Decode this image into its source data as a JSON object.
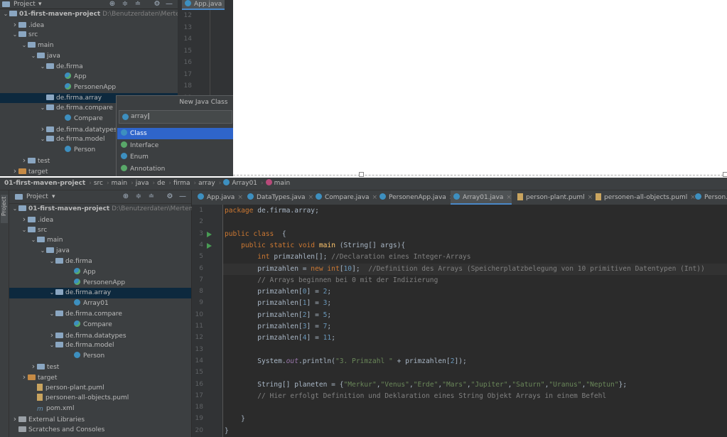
{
  "top": {
    "panel_title": "Project",
    "editor_tab": "App.java",
    "gutter_lines": [
      "12",
      "13",
      "14",
      "15",
      "16",
      "17",
      "18",
      "19"
    ],
    "tree": [
      {
        "label": "01-first-maven-project",
        "path": "D:\\Benutzerdaten\\Mertens_Ach",
        "indent": 0,
        "arrow": "down",
        "icon": "folder"
      },
      {
        "label": ".idea",
        "indent": 1,
        "arrow": "right",
        "icon": "folder"
      },
      {
        "label": "src",
        "indent": 1,
        "arrow": "down",
        "icon": "folder"
      },
      {
        "label": "main",
        "indent": 2,
        "arrow": "down",
        "icon": "folder"
      },
      {
        "label": "java",
        "indent": 3,
        "arrow": "down",
        "icon": "folder"
      },
      {
        "label": "de.firma",
        "indent": 4,
        "arrow": "down",
        "icon": "pkg"
      },
      {
        "label": "App",
        "indent": 6,
        "arrow": "",
        "icon": "class-run"
      },
      {
        "label": "PersonenApp",
        "indent": 6,
        "arrow": "",
        "icon": "class-run"
      },
      {
        "label": "de.firma.array",
        "indent": 4,
        "arrow": "",
        "icon": "pkg",
        "selected": true
      },
      {
        "label": "de.firma.compare",
        "indent": 4,
        "arrow": "down",
        "icon": "pkg"
      },
      {
        "label": "Compare",
        "indent": 6,
        "arrow": "",
        "icon": "class"
      },
      {
        "label": "de.firma.datatypes",
        "indent": 4,
        "arrow": "right",
        "icon": "pkg"
      },
      {
        "label": "de.firma.model",
        "indent": 4,
        "arrow": "down",
        "icon": "pkg"
      },
      {
        "label": "Person",
        "indent": 6,
        "arrow": "",
        "icon": "class"
      },
      {
        "label": "test",
        "indent": 2,
        "arrow": "right",
        "icon": "folder"
      },
      {
        "label": "target",
        "indent": 1,
        "arrow": "right",
        "icon": "orange"
      }
    ],
    "popup": {
      "title": "New Java Class",
      "input_value": "array",
      "items": [
        {
          "label": "Class",
          "color": "#3d8fbf",
          "selected": true
        },
        {
          "label": "Interface",
          "color": "#59a869"
        },
        {
          "label": "Enum",
          "color": "#3d8fbf"
        },
        {
          "label": "Annotation",
          "color": "#59a869"
        }
      ]
    }
  },
  "breadcrumb": [
    "01-first-maven-project",
    "src",
    "main",
    "java",
    "de",
    "firma",
    "array",
    "Array01",
    "main"
  ],
  "main": {
    "panel_title": "Project",
    "side_label": "Project",
    "tree": [
      {
        "label": "01-first-maven-project",
        "path": "D:\\Benutzerdaten\\Mertens_Ach",
        "indent": 0,
        "arrow": "down",
        "icon": "folder"
      },
      {
        "label": ".idea",
        "indent": 1,
        "arrow": "right",
        "icon": "folder"
      },
      {
        "label": "src",
        "indent": 1,
        "arrow": "down",
        "icon": "folder"
      },
      {
        "label": "main",
        "indent": 2,
        "arrow": "down",
        "icon": "folder"
      },
      {
        "label": "java",
        "indent": 3,
        "arrow": "down",
        "icon": "folder"
      },
      {
        "label": "de.firma",
        "indent": 4,
        "arrow": "down",
        "icon": "pkg"
      },
      {
        "label": "App",
        "indent": 6,
        "arrow": "",
        "icon": "class-run"
      },
      {
        "label": "PersonenApp",
        "indent": 6,
        "arrow": "",
        "icon": "class-run"
      },
      {
        "label": "de.firma.array",
        "indent": 4,
        "arrow": "down",
        "icon": "pkg",
        "selected": true
      },
      {
        "label": "Array01",
        "indent": 6,
        "arrow": "",
        "icon": "class"
      },
      {
        "label": "de.firma.compare",
        "indent": 4,
        "arrow": "down",
        "icon": "pkg"
      },
      {
        "label": "Compare",
        "indent": 6,
        "arrow": "",
        "icon": "class-run"
      },
      {
        "label": "de.firma.datatypes",
        "indent": 4,
        "arrow": "right",
        "icon": "pkg"
      },
      {
        "label": "de.firma.model",
        "indent": 4,
        "arrow": "down",
        "icon": "pkg"
      },
      {
        "label": "Person",
        "indent": 6,
        "arrow": "",
        "icon": "class"
      },
      {
        "label": "test",
        "indent": 2,
        "arrow": "right",
        "icon": "folder"
      },
      {
        "label": "target",
        "indent": 1,
        "arrow": "right",
        "icon": "orange"
      },
      {
        "label": "person-plant.puml",
        "indent": 2,
        "arrow": "",
        "icon": "puml"
      },
      {
        "label": "personen-all-objects.puml",
        "indent": 2,
        "arrow": "",
        "icon": "puml"
      },
      {
        "label": "pom.xml",
        "indent": 2,
        "arrow": "",
        "icon": "maven"
      },
      {
        "label": "External Libraries",
        "indent": 0,
        "arrow": "right",
        "icon": "lib"
      },
      {
        "label": "Scratches and Consoles",
        "indent": 0,
        "arrow": "",
        "icon": "scratch"
      }
    ],
    "tabs": [
      {
        "label": "App.java",
        "icon": "class"
      },
      {
        "label": "DataTypes.java",
        "icon": "class"
      },
      {
        "label": "Compare.java",
        "icon": "class"
      },
      {
        "label": "PersonenApp.java",
        "icon": "class"
      },
      {
        "label": "Array01.java",
        "icon": "class",
        "active": true
      },
      {
        "label": "person-plant.puml",
        "icon": "puml"
      },
      {
        "label": "personen-all-objects.puml",
        "icon": "puml"
      },
      {
        "label": "Person.j",
        "icon": "class"
      }
    ],
    "line_numbers": [
      "1",
      "2",
      "3",
      "4",
      "5",
      "6",
      "7",
      "8",
      "9",
      "10",
      "11",
      "12",
      "13",
      "14",
      "15",
      "16",
      "17",
      "18",
      "19",
      "20"
    ],
    "code_lines": [
      "package de.firma.array;",
      "",
      "public class Array01 {",
      "    public static void main (String[] args){",
      "        int primzahlen[]; //Declaration eines Integer-Arrays",
      "        primzahlen = new int[10];  //Definition des Arrays (Speicherplatzbelegung von 10 primitiven Datentypen (Int))",
      "        // Arrays beginnen bei 0 mit der Indizierung",
      "        primzahlen[0] = 2;",
      "        primzahlen[1] = 3;",
      "        primzahlen[2] = 5;",
      "        primzahlen[3] = 7;",
      "        primzahlen[4] = 11;",
      "",
      "        System.out.println(\"3. Primzahl \" + primzahlen[2]);",
      "",
      "        String[] planeten = {\"Merkur\",\"Venus\",\"Erde\",\"Mars\",\"Jupiter\",\"Saturn\",\"Uranus\",\"Neptun\"};",
      "        // Hier erfolgt Definition und Deklaration eines String Objekt Arrays in einem Befehl",
      "",
      "    }",
      "}"
    ]
  }
}
